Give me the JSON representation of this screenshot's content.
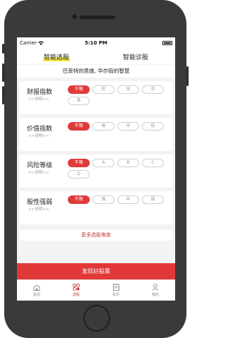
{
  "status_bar": {
    "carrier": "Carrier",
    "time": "5:10 PM"
  },
  "top_tabs": [
    {
      "label": "智能选股",
      "active": true
    },
    {
      "label": "智能诊股",
      "active": false
    }
  ],
  "subtitle": "巴菲特的思维, 华尔街的智慧",
  "filters": [
    {
      "title": "财报指数",
      "link": ">>说明<<",
      "options": [
        {
          "label": "不限",
          "selected": true
        },
        {
          "label": "优",
          "selected": false
        },
        {
          "label": "良",
          "selected": false
        },
        {
          "label": "中",
          "selected": false
        },
        {
          "label": "差",
          "selected": false
        }
      ]
    },
    {
      "title": "价值指数",
      "link": ">>说明<<",
      "options": [
        {
          "label": "不限",
          "selected": true
        },
        {
          "label": "高",
          "selected": false
        },
        {
          "label": "中",
          "selected": false
        },
        {
          "label": "低",
          "selected": false
        }
      ]
    },
    {
      "title": "风险等级",
      "link": ">>说明<<",
      "options": [
        {
          "label": "不限",
          "selected": true
        },
        {
          "label": "A",
          "selected": false
        },
        {
          "label": "B",
          "selected": false
        },
        {
          "label": "C",
          "selected": false
        },
        {
          "label": "D",
          "selected": false
        }
      ]
    },
    {
      "title": "股性强弱",
      "link": ">>说明<<",
      "options": [
        {
          "label": "不限",
          "selected": true
        },
        {
          "label": "强",
          "selected": false
        },
        {
          "label": "中",
          "selected": false
        },
        {
          "label": "弱",
          "selected": false
        }
      ]
    }
  ],
  "more_button": "更多选股角度",
  "discover_button": "发现好股票",
  "tab_bar": [
    {
      "label": "首页",
      "icon": "home-icon",
      "active": false
    },
    {
      "label": "选股",
      "icon": "grid-icon",
      "active": true
    },
    {
      "label": "资讯",
      "icon": "news-icon",
      "active": false
    },
    {
      "label": "我的",
      "icon": "person-icon",
      "active": false
    }
  ],
  "colors": {
    "accent": "#e13838",
    "highlight": "#f7e94a",
    "chip_off": "#d0d0d0"
  }
}
